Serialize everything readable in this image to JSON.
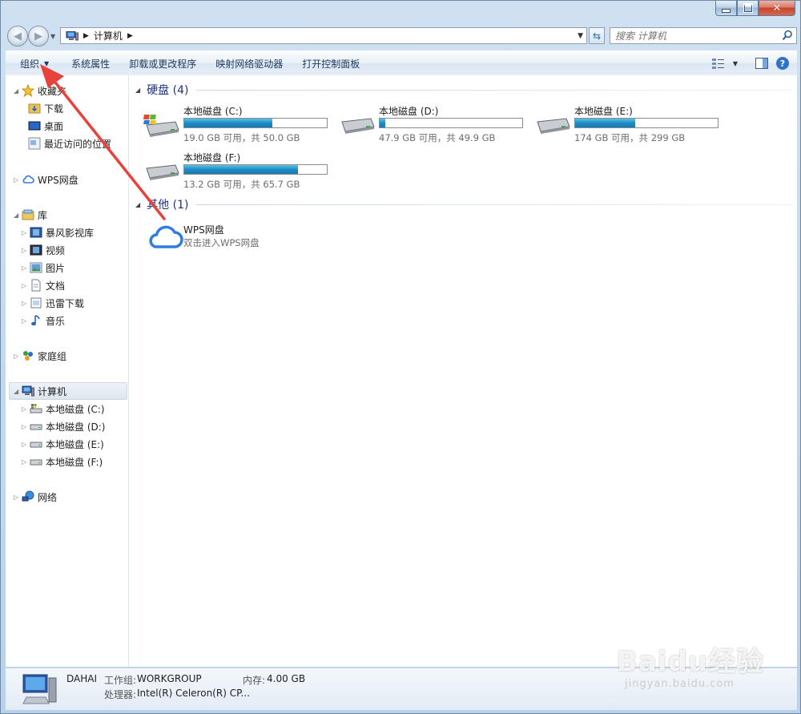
{
  "window": {
    "controls": {
      "minimize": "–",
      "maximize": "□",
      "close": "✕"
    }
  },
  "nav": {
    "address": [
      "计算机"
    ],
    "search_placeholder": "搜索 计算机"
  },
  "commands": {
    "organize": "组织",
    "items": [
      "系统属性",
      "卸载或更改程序",
      "映射网络驱动器",
      "打开控制面板"
    ]
  },
  "tree": {
    "favorites": {
      "label": "收藏夹",
      "children": [
        "下载",
        "桌面",
        "最近访问的位置"
      ]
    },
    "wps": "WPS网盘",
    "libraries": {
      "label": "库",
      "children": [
        "暴风影视库",
        "视频",
        "图片",
        "文档",
        "迅雷下载",
        "音乐"
      ]
    },
    "homegroup": "家庭组",
    "computer": {
      "label": "计算机",
      "children": [
        "本地磁盘 (C:)",
        "本地磁盘 (D:)",
        "本地磁盘 (E:)",
        "本地磁盘 (F:)"
      ]
    },
    "network": "网络"
  },
  "groups": {
    "hard_disks": "硬盘 (4)",
    "other": "其他 (1)"
  },
  "drives": [
    {
      "name": "本地磁盘 (C:)",
      "info": "19.0 GB 可用，共 50.0 GB",
      "used_fraction": 0.62,
      "system": true
    },
    {
      "name": "本地磁盘 (D:)",
      "info": "47.9 GB 可用，共 49.9 GB",
      "used_fraction": 0.04,
      "system": false
    },
    {
      "name": "本地磁盘 (E:)",
      "info": "174 GB 可用，共 299 GB",
      "used_fraction": 0.42,
      "system": false
    },
    {
      "name": "本地磁盘 (F:)",
      "info": "13.2 GB 可用，共 65.7 GB",
      "used_fraction": 0.8,
      "system": false
    }
  ],
  "other_items": [
    {
      "name": "WPS网盘",
      "desc": "双击进入WPS网盘"
    }
  ],
  "status": {
    "computer_name": "DAHAI",
    "workgroup_label": "工作组:",
    "workgroup": "WORKGROUP",
    "memory_label": "内存:",
    "memory": "4.00 GB",
    "cpu_label": "处理器:",
    "cpu": "Intel(R) Celeron(R) CP..."
  },
  "watermark": {
    "main": "Baidu经验",
    "sub": "jingyan.baidu.com"
  },
  "colors": {
    "annotation_arrow": "#e8423a",
    "group_header": "#1e3287",
    "capacity_bar": "#1f8bc6"
  }
}
